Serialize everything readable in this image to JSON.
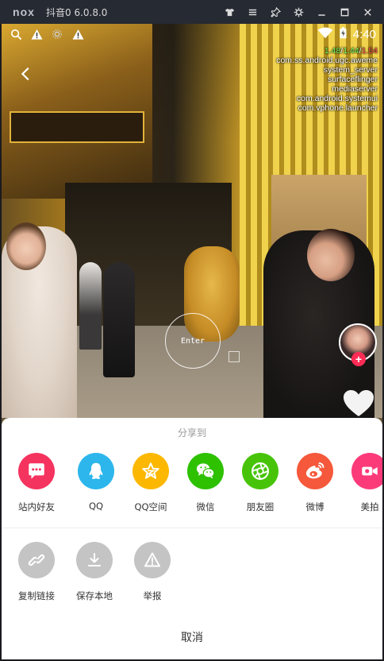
{
  "emulator": {
    "logo": "nox",
    "title": "抖音0 6.0.8.0",
    "controls": [
      "shirt-icon",
      "menu-icon",
      "pin-icon",
      "gear-icon",
      "minimize-icon",
      "maximize-icon",
      "close-icon"
    ]
  },
  "status_bar": {
    "time": "4:40",
    "left_icons": [
      "search-icon",
      "warning-icon",
      "settings-icon",
      "warning-icon"
    ],
    "right_icons": [
      "wifi-icon",
      "battery-icon"
    ]
  },
  "video": {
    "enter_label": "Enter",
    "debug": {
      "fps_1": "1.48",
      "fps_2": "1.44",
      "fps_3": "1.54",
      "processes": [
        "com.ss.android.ugc.aweme",
        "system_server",
        "surfaceflinger",
        "mediaserver",
        "com.android.systemui",
        "com.vphone.launcher"
      ]
    },
    "follow_label": "+"
  },
  "share_sheet": {
    "title": "分享到",
    "targets": [
      {
        "label": "站内好友",
        "color": "#f5335f",
        "icon": "chat-bubble-icon"
      },
      {
        "label": "QQ",
        "color": "#2cb6ec",
        "icon": "qq-penguin-icon"
      },
      {
        "label": "QQ空间",
        "color": "#fcb800",
        "icon": "qzone-star-icon"
      },
      {
        "label": "微信",
        "color": "#2dc100",
        "icon": "wechat-icon"
      },
      {
        "label": "朋友圈",
        "color": "#47c40a",
        "icon": "moments-icon"
      },
      {
        "label": "微博",
        "color": "#f5583a",
        "icon": "weibo-icon"
      },
      {
        "label": "美拍",
        "color": "#fc3a7a",
        "icon": "meipai-icon"
      }
    ],
    "actions": [
      {
        "label": "复制链接",
        "icon": "link-icon"
      },
      {
        "label": "保存本地",
        "icon": "download-icon"
      },
      {
        "label": "举报",
        "icon": "report-icon"
      }
    ],
    "cancel": "取消"
  }
}
